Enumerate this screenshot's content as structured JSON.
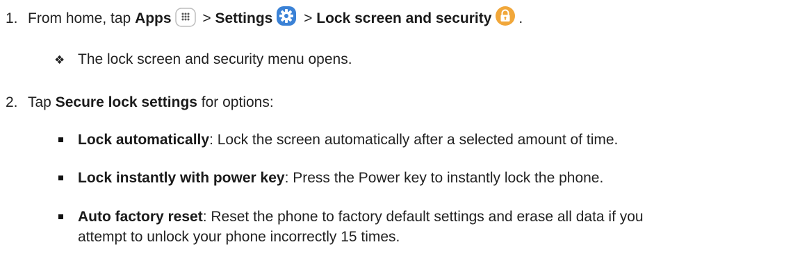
{
  "steps": [
    {
      "number": "1.",
      "text_from_home": "From home, tap ",
      "apps_label": "Apps",
      "sep1": " > ",
      "settings_label": "Settings",
      "sep2": " > ",
      "lock_label": "Lock screen and security",
      "end": "."
    },
    {
      "number": "2.",
      "text_tap": "Tap ",
      "secure_label": "Secure lock settings",
      "text_rest": " for options:"
    }
  ],
  "step1_result": "The lock screen and security menu opens.",
  "options": [
    {
      "name": "Lock automatically",
      "desc": ": Lock the screen automatically after a selected amount of time."
    },
    {
      "name": "Lock instantly with power key",
      "desc": ": Press the Power key to instantly lock the phone."
    },
    {
      "name": "Auto factory reset",
      "desc": ": Reset the phone to factory default settings and erase all data if you",
      "desc_cont": "attempt to unlock your phone incorrectly 15 times."
    }
  ],
  "icons": {
    "apps": "apps-grid-icon",
    "settings": "gear-icon",
    "lock": "lock-icon"
  },
  "colors": {
    "settings_blue": "#3b82d6",
    "lock_orange": "#f1a73a"
  }
}
